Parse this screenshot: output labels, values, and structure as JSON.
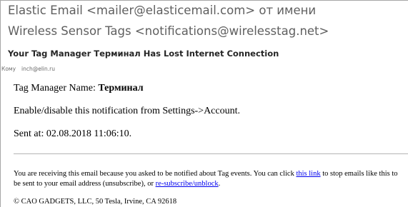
{
  "header": {
    "from_line_1": "Elastic Email <mailer@elasticemail.com> от имени",
    "from_line_2": "Wireless Sensor Tags <notifications@wirelesstag.net>",
    "subject": "Your Tag Manager Терминал Has Lost Internet Connection",
    "to_label": "Кому",
    "to_value": "inch@elin.ru"
  },
  "body": {
    "manager_label": "Tag Manager Name: ",
    "manager_name": "Терминал",
    "enable_text": "Enable/disable this notification from Settings->Account.",
    "sent_label": "Sent at: ",
    "sent_value": "02.08.2018 11:06:10."
  },
  "footer": {
    "text_1": "You are receiving this email because you asked to be notified about Tag events. You can click ",
    "link_1": "this link",
    "text_2": " to stop emails like this to be sent to your email address (unsubscribe), or ",
    "link_2": "re-subscribe/unblock",
    "text_3": ".",
    "copyright": "© CAO GADGETS, LLC, 50 Tesla, Irvine, CA 92618"
  },
  "colors": {
    "header_text": "#5f5f5f",
    "link": "#0000ee",
    "divider": "#b4b4b4"
  }
}
